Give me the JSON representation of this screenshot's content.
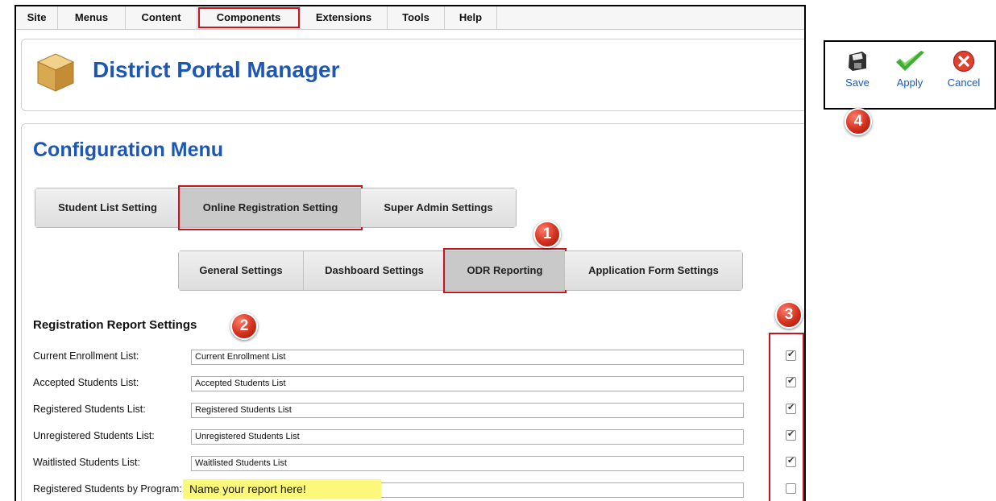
{
  "menubar": {
    "items": [
      "Site",
      "Menus",
      "Content",
      "Components",
      "Extensions",
      "Tools",
      "Help"
    ]
  },
  "header": {
    "title": "District Portal Manager",
    "icon": "package-box-icon"
  },
  "config": {
    "title": "Configuration Menu",
    "main_tabs": [
      "Student List Setting",
      "Online Registration Setting",
      "Super Admin Settings"
    ],
    "active_main_tab": "Online Registration Setting",
    "sub_tabs": [
      "General Settings",
      "Dashboard Settings",
      "ODR Reporting",
      "Application Form Settings"
    ],
    "active_sub_tab": "ODR Reporting"
  },
  "report_settings": {
    "title": "Registration Report Settings",
    "rows": [
      {
        "label": "Current Enrollment List:",
        "value": "Current Enrollment List",
        "checked": true
      },
      {
        "label": "Accepted Students List:",
        "value": "Accepted Students List",
        "checked": true
      },
      {
        "label": "Registered Students List:",
        "value": "Registered Students List",
        "checked": true
      },
      {
        "label": "Unregistered Students List:",
        "value": "Unregistered Students List",
        "checked": true
      },
      {
        "label": "Waitlisted Students List:",
        "value": "Waitlisted Students List",
        "checked": true
      },
      {
        "label": "Registered Students by Program:",
        "value": "",
        "checked": false
      }
    ],
    "note": "Name your report here!"
  },
  "toolbar": {
    "save": "Save",
    "apply": "Apply",
    "cancel": "Cancel"
  },
  "callouts": [
    "1",
    "2",
    "3",
    "4"
  ],
  "colors": {
    "accent": "#1d57b6",
    "highlight": "#c8141e",
    "note": "#fcf97a"
  }
}
